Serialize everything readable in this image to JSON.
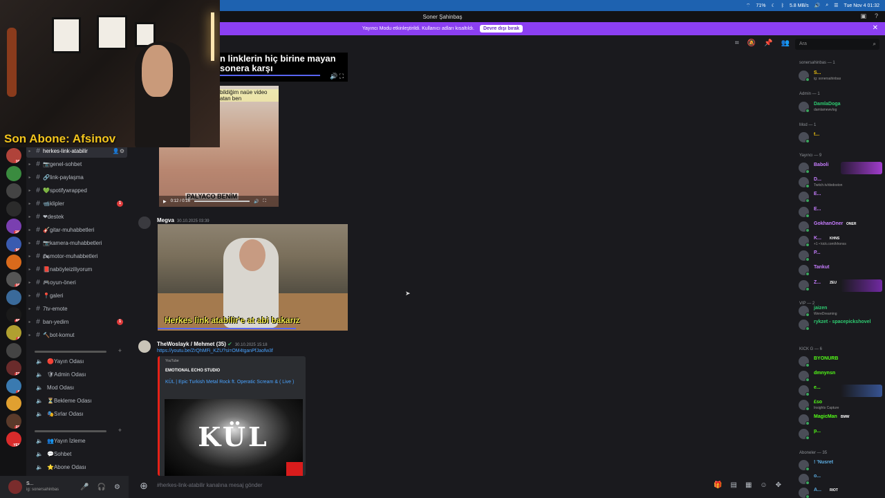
{
  "menubar": {
    "battery": "71%",
    "network": "5.8 MB/s",
    "datetime": "Tue Nov 4 01:32"
  },
  "window": {
    "title": "Soner Şahinbaş"
  },
  "banner": {
    "text": "Yayıncı Modu etkinleştirildi. Kullanıcı adları kısaltıldı.",
    "button": "Devre dışı bırak"
  },
  "overlay": {
    "son_abone": "Son Abone: Afsinov"
  },
  "guilds": [
    {
      "badge": "167"
    },
    {
      "badge": ""
    },
    {
      "badge": ""
    },
    {
      "badge": ""
    },
    {
      "badge": "1K+"
    },
    {
      "badge": "964"
    },
    {
      "badge": ""
    },
    {
      "badge": "165"
    },
    {
      "badge": ""
    },
    {
      "badge": "482"
    },
    {
      "badge": "65"
    },
    {
      "badge": ""
    },
    {
      "badge": "271"
    },
    {
      "badge": "80"
    },
    {
      "badge": ""
    },
    {
      "badge": "316"
    },
    {
      "badge": "YENİ"
    }
  ],
  "channels": [
    {
      "label": "herkes-link-atabilir",
      "active": true,
      "badge": ""
    },
    {
      "label": "📷genel-sohbet",
      "badge": ""
    },
    {
      "label": "🔗link-paylaşma",
      "badge": ""
    },
    {
      "label": "💚spotifywrapped",
      "badge": ""
    },
    {
      "label": "📹klipler",
      "badge": "1"
    },
    {
      "label": "❤destek",
      "badge": ""
    },
    {
      "label": "🎸gitar-muhabbetleri",
      "badge": ""
    },
    {
      "label": "📷kamera-muhabbetleri",
      "badge": ""
    },
    {
      "label": "🏍motor-muhabbetleri",
      "badge": ""
    },
    {
      "label": "📕naböyleiziliyorum",
      "badge": ""
    },
    {
      "label": "🎮oyun-öneri",
      "badge": ""
    },
    {
      "label": "📍galeri",
      "badge": ""
    },
    {
      "label": "7tv-emote",
      "badge": ""
    },
    {
      "label": "ban-yedim",
      "badge": "1"
    },
    {
      "label": "🔨bot-komut",
      "badge": ""
    }
  ],
  "voice_group1": [
    "🔴Yayın Odası",
    "🛡Admin Odası",
    "Mod Odası",
    "⏳Bekleme Odası",
    "🎭Sırlar Odası"
  ],
  "voice_group2": [
    "👥Yayın İzleme",
    "💬Sohbet",
    "⭐Abone Odası"
  ],
  "user": {
    "name": "S...",
    "sub": "ig: sonersahinbas"
  },
  "toolbar": {
    "search_placeholder": "Ara"
  },
  "video1": {
    "caption": "n linklerin hiç birine mayan sonera karşı"
  },
  "video2": {
    "caption": "bildiğim naüe video atan ben",
    "bottom": "PALYACO BENİM",
    "time": "0:12 / 0:16"
  },
  "messages": [
    {
      "name": "Megva",
      "time": "30.10.2025 03:39"
    },
    {
      "name": "TheWoslayk / Mehmet (35)",
      "time": "30.10.2025 15:18"
    }
  ],
  "video3": {
    "caption": "Herkes link atabilir'e at abi bakarız",
    "time": "0:17 / 0:17"
  },
  "link": "https://youtu.be/ZrQhMFi_KZU?si=OM4tganPfJaofw3f",
  "embed": {
    "provider": "YouTube",
    "author": "EMOTIONAL ECHO STUDIO",
    "title": "KÜL | Epic Turkish Metal Rock ft. Operatic Scream & ( Live )",
    "thumb_text": "KÜL"
  },
  "input": {
    "placeholder": "#herkes-link-atabilir kanalına mesaj gönder"
  },
  "members": {
    "groups": [
      {
        "header": "sonersahinbas — 1",
        "items": [
          {
            "name": "S...",
            "sub": "ig: sonersahinbas",
            "color": "#f1c40f"
          }
        ]
      },
      {
        "header": "Admin — 1",
        "items": [
          {
            "name": "DamlaDoga",
            "sub": "damlamewvlog",
            "color": "#2ecc71"
          }
        ]
      },
      {
        "header": "Mod — 1",
        "items": [
          {
            "name": "t...",
            "sub": "",
            "color": "#f1c40f"
          }
        ]
      },
      {
        "header": "Yayıncı — 9",
        "items": [
          {
            "name": "Baboli",
            "sub": "",
            "color": "#c77dff",
            "grad": "linear-gradient(90deg,#2b1a3a,#b040e0)"
          },
          {
            "name": "D...",
            "sub": "Twitch.tv/dodoston",
            "color": "#c77dff"
          },
          {
            "name": "E...",
            "sub": "",
            "color": "#c77dff"
          },
          {
            "name": "E...",
            "sub": "",
            "color": "#c77dff"
          },
          {
            "name": "GokhanOner",
            "sub": "",
            "color": "#c77dff",
            "tag": "ONER"
          },
          {
            "name": "K...",
            "sub": "+1 • kick.com/khonss",
            "color": "#c77dff",
            "tag": "KHNS"
          },
          {
            "name": "P...",
            "sub": "",
            "color": "#c77dff"
          },
          {
            "name": "Tankut",
            "sub": "",
            "color": "#c77dff"
          },
          {
            "name": "Z...",
            "sub": "",
            "color": "#c77dff",
            "tag": "ZEU",
            "grad": "linear-gradient(90deg,#1a1a1e,#7a2bb0)"
          }
        ]
      },
      {
        "header": "VIP — 2",
        "items": [
          {
            "name": "jaizen",
            "sub": "WereDreaming",
            "color": "#2ecc71"
          },
          {
            "name": "rykzet - spacepickshovel",
            "sub": "",
            "color": "#2ecc71"
          }
        ]
      },
      {
        "header": "KICK G — 6",
        "items": [
          {
            "name": "BYONURB",
            "sub": "",
            "color": "#53fc18"
          },
          {
            "name": "dmnynsn",
            "sub": "",
            "color": "#53fc18"
          },
          {
            "name": "e...",
            "sub": "",
            "color": "#53fc18",
            "grad": "linear-gradient(90deg,#1a1a1e,#3a5aa0)"
          },
          {
            "name": "£so",
            "sub": "Insights Capture",
            "color": "#53fc18"
          },
          {
            "name": "MagicMan",
            "sub": "",
            "color": "#53fc18",
            "tag": "BMW"
          },
          {
            "name": "p...",
            "sub": "",
            "color": "#53fc18"
          }
        ]
      },
      {
        "header": "Aboneler — 35",
        "items": [
          {
            "name": "! 'Nusret",
            "sub": "",
            "color": "#5dade2"
          },
          {
            "name": "o...",
            "sub": "",
            "color": "#5dade2"
          },
          {
            "name": "A...",
            "sub": "",
            "color": "#5dade2",
            "tag": "RIOT"
          }
        ]
      }
    ]
  }
}
